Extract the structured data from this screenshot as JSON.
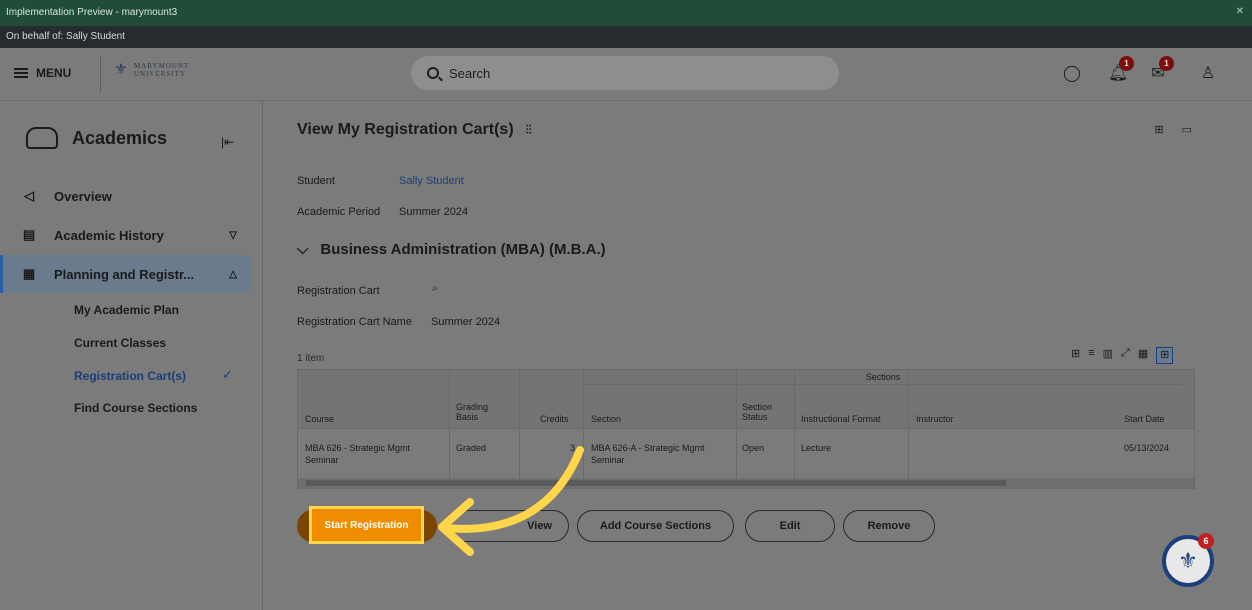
{
  "window": {
    "title": "Implementation Preview - marymount3",
    "on_behalf": "On behalf of: Sally Student"
  },
  "header": {
    "menu_label": "MENU",
    "logo_line1": "MARYMOUNT",
    "logo_line2": "UNIVERSITY",
    "search_placeholder": "Search",
    "notif_count": "1",
    "inbox_count": "1"
  },
  "sidebar": {
    "title": "Academics",
    "items": [
      {
        "label": "Overview"
      },
      {
        "label": "Academic History"
      },
      {
        "label": "Planning and Registr..."
      }
    ],
    "sub_items": [
      {
        "label": "My Academic Plan"
      },
      {
        "label": "Current Classes"
      },
      {
        "label": "Registration Cart(s)"
      },
      {
        "label": "Find Course Sections"
      }
    ]
  },
  "main": {
    "title": "View My Registration Cart(s)",
    "student_label": "Student",
    "student_value": "Sally Student",
    "period_label": "Academic Period",
    "period_value": "Summer 2024",
    "program": "Business Administration (MBA) (M.B.A.)",
    "cart_label": "Registration Cart",
    "cart_name_label": "Registration Cart Name",
    "cart_name_value": "Summer 2024",
    "item_count": "1 item",
    "table": {
      "group_header": "Sections",
      "columns": [
        "Course",
        "Grading Basis",
        "Credits",
        "Section",
        "Section Status",
        "Instructional Format",
        "Instructor",
        "Start Date"
      ],
      "row": {
        "course": "MBA 626 - Strategic Mgmt Seminar",
        "grading": "Graded",
        "credits": "3",
        "section": "MBA 626-A - Strategic Mgmt Seminar",
        "status": "Open",
        "format": "Lecture",
        "instructor": "",
        "start_date": "05/13/2024"
      }
    },
    "buttons": {
      "start": "Start Registration",
      "view": "View",
      "add": "Add Course Sections",
      "edit": "Edit",
      "remove": "Remove"
    }
  },
  "help_badge": "6"
}
